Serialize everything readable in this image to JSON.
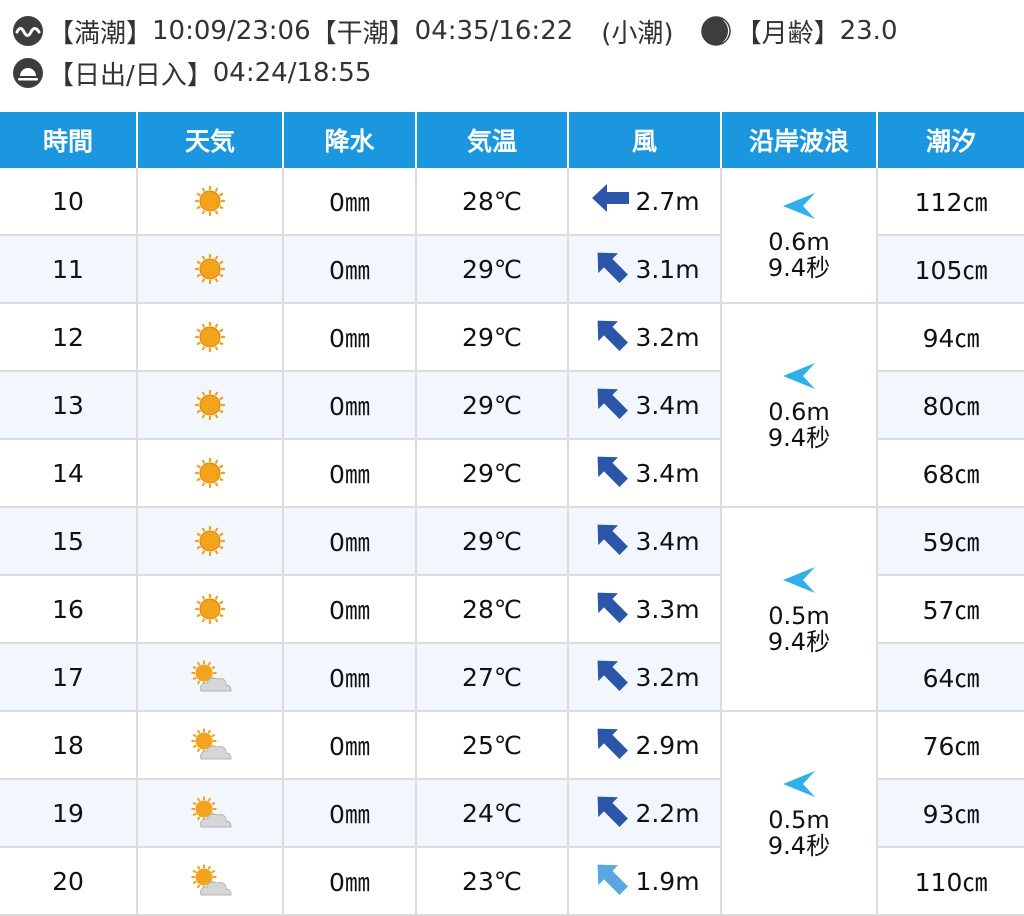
{
  "info": {
    "tide_high_label": "【満潮】",
    "tide_high_times": "10:09/23:06",
    "tide_low_label": "【干潮】",
    "tide_low_times": "04:35/16:22",
    "tide_type": "(小潮)",
    "moon_age_label": "【月齢】",
    "moon_age": "23.0",
    "sun_label": "【日出/日入】",
    "sun_times": "04:24/18:55"
  },
  "headers": [
    "時間",
    "天気",
    "降水",
    "気温",
    "風",
    "沿岸波浪",
    "潮汐"
  ],
  "rows": [
    {
      "hour": "10",
      "weather": "sunny-icon",
      "precip": "0㎜",
      "temp": "28℃",
      "wind_dir": "W",
      "wind": "2.7m",
      "tide": "112㎝"
    },
    {
      "hour": "11",
      "weather": "sunny-icon",
      "precip": "0㎜",
      "temp": "29℃",
      "wind_dir": "NW",
      "wind": "3.1m",
      "tide": "105㎝"
    },
    {
      "hour": "12",
      "weather": "sunny-icon",
      "precip": "0㎜",
      "temp": "29℃",
      "wind_dir": "NW",
      "wind": "3.2m",
      "tide": "94㎝"
    },
    {
      "hour": "13",
      "weather": "sunny-icon",
      "precip": "0㎜",
      "temp": "29℃",
      "wind_dir": "NW",
      "wind": "3.4m",
      "tide": "80㎝"
    },
    {
      "hour": "14",
      "weather": "sunny-icon",
      "precip": "0㎜",
      "temp": "29℃",
      "wind_dir": "NW",
      "wind": "3.4m",
      "tide": "68㎝"
    },
    {
      "hour": "15",
      "weather": "sunny-icon",
      "precip": "0㎜",
      "temp": "29℃",
      "wind_dir": "NW",
      "wind": "3.4m",
      "tide": "59㎝"
    },
    {
      "hour": "16",
      "weather": "sunny-icon",
      "precip": "0㎜",
      "temp": "28℃",
      "wind_dir": "NW",
      "wind": "3.3m",
      "tide": "57㎝"
    },
    {
      "hour": "17",
      "weather": "sunny-cloudy-icon",
      "precip": "0㎜",
      "temp": "27℃",
      "wind_dir": "NW",
      "wind": "3.2m",
      "tide": "64㎝"
    },
    {
      "hour": "18",
      "weather": "sunny-cloudy-icon",
      "precip": "0㎜",
      "temp": "25℃",
      "wind_dir": "NW",
      "wind": "2.9m",
      "tide": "76㎝"
    },
    {
      "hour": "19",
      "weather": "sunny-cloudy-icon",
      "precip": "0㎜",
      "temp": "24℃",
      "wind_dir": "NW",
      "wind": "2.2m",
      "tide": "93㎝"
    },
    {
      "hour": "20",
      "weather": "sunny-cloudy-icon",
      "precip": "0㎜",
      "temp": "23℃",
      "wind_dir": "NW-light",
      "wind": "1.9m",
      "tide": "110㎝"
    }
  ],
  "waves": [
    {
      "height": "0.6m",
      "period": "9.4秒"
    },
    {
      "height": "0.6m",
      "period": "9.4秒"
    },
    {
      "height": "0.5m",
      "period": "9.4秒"
    },
    {
      "height": "0.5m",
      "period": "9.4秒"
    }
  ],
  "colors": {
    "header_bg": "#1a97df",
    "row_alt_bg": "#f1f7fd",
    "wind_arrow": "#2c56a8",
    "wind_arrow_light": "#5aa7df",
    "wave_arrow": "#2fb0ea",
    "sun": "#f4a31c"
  }
}
